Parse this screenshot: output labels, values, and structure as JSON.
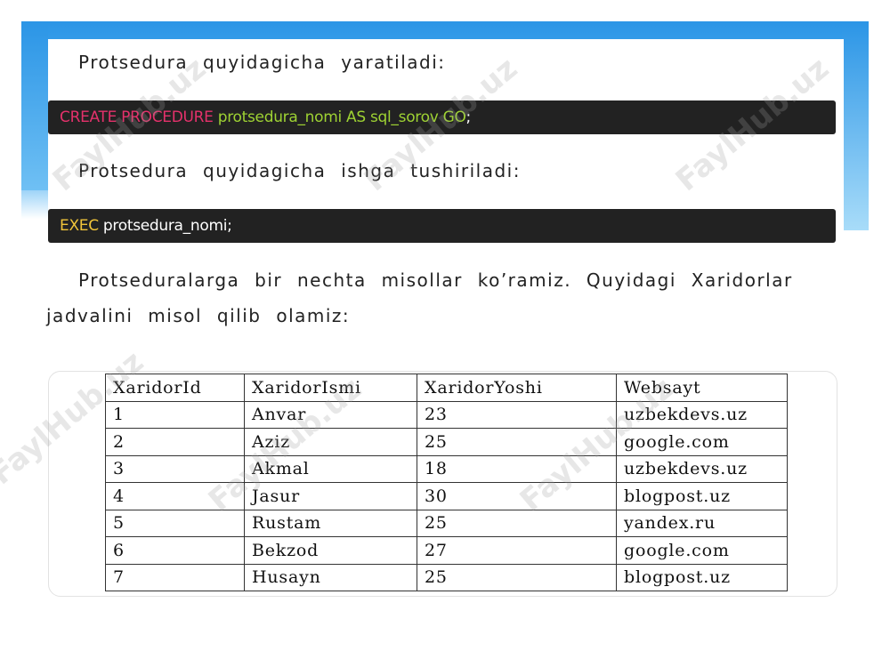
{
  "paragraphs": {
    "create_intro": "Protsedura quyidagicha yaratiladi:",
    "exec_intro": "Protsedura quyidagicha ishga tushiriladi:",
    "examples_line1": "Protseduralarga bir nechta misollar ko’ramiz. Quyidagi Xaridorlar",
    "examples_line2": "jadvalini misol qilib olamiz:"
  },
  "code": {
    "create": {
      "keyword": "CREATE PROCEDURE",
      "rest": " protsedura_nomi AS sql_sorov GO",
      "end": ";"
    },
    "exec": {
      "keyword": "EXEC",
      "rest": " protsedura_nomi;"
    }
  },
  "table": {
    "headers": [
      "XaridorId",
      "XaridorIsmi",
      "XaridorYoshi",
      "Websayt"
    ],
    "rows": [
      [
        "1",
        "Anvar",
        "23",
        "uzbekdevs.uz"
      ],
      [
        "2",
        "Aziz",
        "25",
        "google.com"
      ],
      [
        "3",
        "Akmal",
        "18",
        "uzbekdevs.uz"
      ],
      [
        "4",
        "Jasur",
        "30",
        "blogpost.uz"
      ],
      [
        "5",
        "Rustam",
        "25",
        "yandex.ru"
      ],
      [
        "6",
        "Bekzod",
        "27",
        "google.com"
      ],
      [
        "7",
        "Husayn",
        "25",
        "blogpost.uz"
      ]
    ]
  },
  "watermark": "FaylHub.uz",
  "colors": {
    "keyword_pink": "#e4316b",
    "keyword_green": "#9ed233",
    "keyword_yellow": "#f0c43a",
    "code_background": "#222222",
    "frame_blue": "#2b95e6"
  }
}
